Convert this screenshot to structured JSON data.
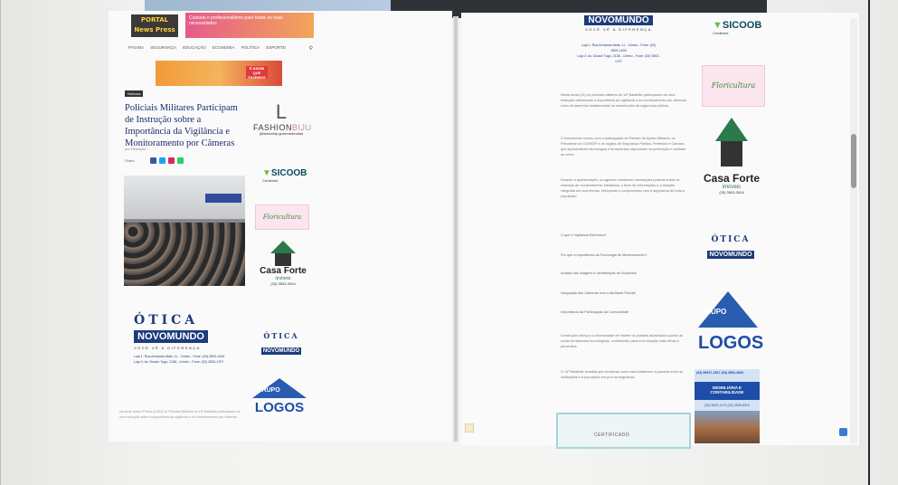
{
  "colors": {
    "title_blue": "#1a2b6b",
    "brand_navy": "#1c3c7a",
    "sicoob_teal": "#0a4b5c",
    "sicoob_green": "#7ab648",
    "logos_blue": "#1d4da8",
    "casa_green": "#2a7a4a"
  },
  "left_page": {
    "site_logo": "PORTAL\nNews Press",
    "top_ad": "Cuidado e profissionalismo para todas as suas necessidades",
    "nav": [
      "PÁGINA",
      "SEGURANÇA",
      "EDUCAÇÃO",
      "ECONOMIA",
      "POLÍTICA",
      "ESPORTE"
    ],
    "ad_banner": "É ASSIM QUE FAZEMOS",
    "category": "Notícias",
    "title": "Policiais Militares Participam de Instrução sobre a Importância da Vigilância e Monitoramento por Câmeras",
    "meta": "por Redação   · ·",
    "share_label": "Share",
    "otica": {
      "word": "ÓTICA",
      "name": "NOVOMUNDO",
      "tagline": "VOCÊ VÊ A DIFERENÇA",
      "addr1": "Loja 1: Rua Armando Abila, 11 - Centro - Fone: (33) 3503-1403",
      "addr2": "Loja 2: Av. Doutor Tugo, 2138 - Centro - Fone: (33) 3503-1707"
    },
    "footer_text": "Na tarde desta 2ª feira (21/03) os Policiais Militares do 14º Batalhão participaram de uma instrução sobre a importância da vigilância e do monitoramento por câmeras."
  },
  "sidebar": {
    "fashion": {
      "mark": "L",
      "name_a": "FASHION",
      "name_b": "BIJU",
      "ig": "@fashionbiju.governadorvalad"
    },
    "sicoob": {
      "name": "SICOOB",
      "sub": "Credimed"
    },
    "floricultura": "Floricultura",
    "casa_forte": {
      "name": "Casa Forte",
      "sub": "imóveis",
      "phone": "(33) 3503-3004"
    },
    "otica_small": {
      "word": "ÓTICA",
      "name": "NOVOMUNDO"
    },
    "logos": {
      "grupo": "GRUPO",
      "name": "LOGOS"
    }
  },
  "right_page": {
    "otica": {
      "name": "NOVOMUNDO",
      "tagline": "VOCÊ VÊ A DIFERENÇA",
      "addr1": "Loja 1: Rua Armando Abila, 11 - Centro - Fone: (33) 3503-1403",
      "addr2": "Loja 2: Av. Doutor Tugo, 2138 - Centro - Fone: (33) 3503-1707"
    },
    "paragraphs": [
      "Nesta sexta (21) os policiais militares do 14º Batalhão participaram de uma instrução destacando a importância da vigilância e do monitoramento por câmeras como ferramentas fundamentais na manutenção da segurança pública.",
      "O treinamento contou com a participação do Pelotão de Ações Militares, do Presidente do CONSEP e de órgãos de Segurança Pública, Prefeitura e Câmara, que apresentaram tecnologias e ferramentas disponíveis na prevenção e combate ao crime.",
      "Durante a apresentação, os agentes receberam orientações práticas sobre os sistemas de monitoramento instalados, o fluxo de informações e a atuação integrada em ocorrências, reforçando o compromisso com a segurança de toda a população.",
      "Questões abordadas durante a instrução incluíram os pontos abaixo:"
    ],
    "questions": [
      "O que é Vigilância Eletrônica?",
      "Por que a Importância da Tecnologia de Monitoramento?",
      "Análise das Imagens e Identificação de Suspeitos",
      "Integração das Câmeras com a Atividade Policial",
      "Importância da Participação da Comunidade"
    ],
    "closing": [
      "A instrução reforçou a necessidade de manter os policiais atualizados quanto às novas ferramentas tecnológicas, contribuindo para uma atuação mais eficaz e preventiva.",
      "O 14º Batalhão ressalta que iniciativas como esta fortalecem a parceria entre as instituições e a população em prol da segurança."
    ],
    "cert_label": "CERTIFICADO",
    "imob": {
      "row1": "(33) 99917-2517   (33) 3502-3000",
      "title": "IMOBILIÁRIA E CONTABILIDADE",
      "phones": "(33) 3503-1172   (33) 3505-8313"
    }
  }
}
